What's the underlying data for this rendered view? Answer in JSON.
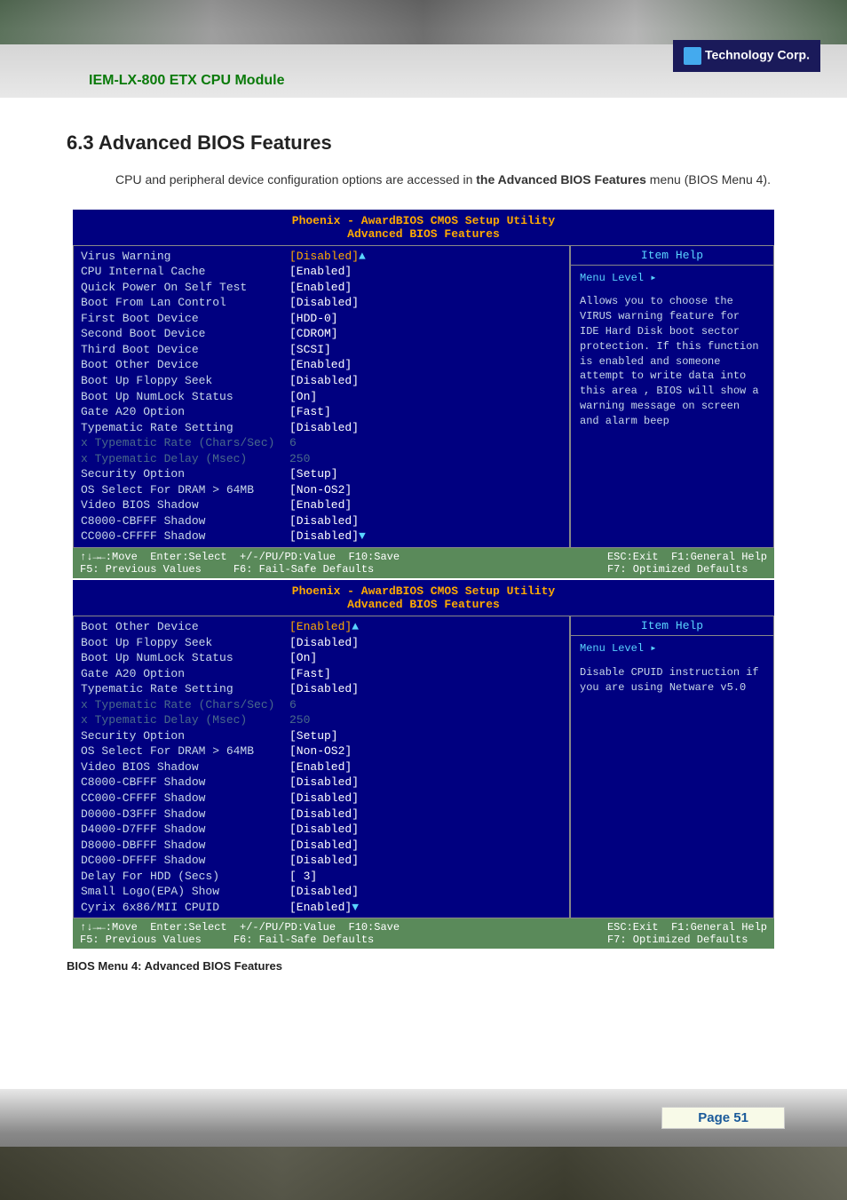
{
  "header": {
    "module": "IEM-LX-800 ETX CPU Module",
    "logo": "Technology Corp."
  },
  "section": {
    "heading": "6.3 Advanced BIOS Features",
    "intro_part1": "CPU and peripheral device configuration options are accessed in ",
    "intro_bold1": "the Advanced BIOS Features",
    "intro_part2": " menu (BIOS Menu 4)."
  },
  "bios1": {
    "title1": "Phoenix - AwardBIOS CMOS Setup Utility",
    "title2": "Advanced BIOS Features",
    "rows": [
      {
        "label": "Virus Warning",
        "value": "[Disabled]",
        "valClass": "yellow"
      },
      {
        "label": "CPU Internal Cache",
        "value": "[Enabled]"
      },
      {
        "label": "Quick Power On Self Test",
        "value": "[Enabled]"
      },
      {
        "label": "Boot From Lan Control",
        "value": "[Disabled]"
      },
      {
        "label": "First Boot Device",
        "value": "[HDD-0]"
      },
      {
        "label": "Second Boot Device",
        "value": "[CDROM]"
      },
      {
        "label": "Third Boot Device",
        "value": "[SCSI]"
      },
      {
        "label": "Boot Other Device",
        "value": "[Enabled]"
      },
      {
        "label": "Boot Up Floppy Seek",
        "value": "[Disabled]"
      },
      {
        "label": "Boot Up NumLock Status",
        "value": "[On]"
      },
      {
        "label": "Gate A20 Option",
        "value": "[Fast]"
      },
      {
        "label": "Typematic Rate Setting",
        "value": "[Disabled]"
      },
      {
        "label": "x Typematic Rate (Chars/Sec)",
        "value": "6",
        "dim": true
      },
      {
        "label": "x Typematic Delay (Msec)",
        "value": "250",
        "dim": true
      },
      {
        "label": "Security Option",
        "value": "[Setup]"
      },
      {
        "label": "OS Select For DRAM > 64MB",
        "value": "[Non-OS2]"
      },
      {
        "label": "Video BIOS Shadow",
        "value": "[Enabled]"
      },
      {
        "label": "C8000-CBFFF Shadow",
        "value": "[Disabled]"
      },
      {
        "label": "CC000-CFFFF Shadow",
        "value": "[Disabled]"
      }
    ],
    "help_title": "Item Help",
    "menu_level": "Menu Level   ▸",
    "help_text": "Allows you to choose the VIRUS warning feature for IDE Hard Disk boot sector protection. If this function is enabled and someone attempt to write data into this area , BIOS will show a warning message on screen and alarm beep",
    "footer_l1": "↑↓→←:Move  Enter:Select  +/-/PU/PD:Value  F10:Save",
    "footer_l2": "F5: Previous Values     F6: Fail-Safe Defaults",
    "footer_r1": "ESC:Exit  F1:General Help",
    "footer_r2": "F7: Optimized Defaults"
  },
  "bios2": {
    "title1": "Phoenix - AwardBIOS CMOS Setup Utility",
    "title2": "Advanced BIOS Features",
    "rows": [
      {
        "label": "Boot Other Device",
        "value": "[Enabled]",
        "valClass": "yellow"
      },
      {
        "label": "Boot Up Floppy Seek",
        "value": "[Disabled]"
      },
      {
        "label": "Boot Up NumLock Status",
        "value": "[On]"
      },
      {
        "label": "Gate A20 Option",
        "value": "[Fast]"
      },
      {
        "label": "Typematic Rate Setting",
        "value": "[Disabled]"
      },
      {
        "label": "x Typematic Rate (Chars/Sec)",
        "value": "6",
        "dim": true
      },
      {
        "label": "x Typematic Delay (Msec)",
        "value": "250",
        "dim": true
      },
      {
        "label": "Security Option",
        "value": "[Setup]"
      },
      {
        "label": "OS Select For DRAM > 64MB",
        "value": "[Non-OS2]"
      },
      {
        "label": "Video BIOS Shadow",
        "value": "[Enabled]"
      },
      {
        "label": "C8000-CBFFF Shadow",
        "value": "[Disabled]"
      },
      {
        "label": "CC000-CFFFF Shadow",
        "value": "[Disabled]"
      },
      {
        "label": "D0000-D3FFF Shadow",
        "value": "[Disabled]"
      },
      {
        "label": "D4000-D7FFF Shadow",
        "value": "[Disabled]"
      },
      {
        "label": "D8000-DBFFF Shadow",
        "value": "[Disabled]"
      },
      {
        "label": "DC000-DFFFF Shadow",
        "value": "[Disabled]"
      },
      {
        "label": "Delay For HDD (Secs)",
        "value": "[ 3]"
      },
      {
        "label": "Small Logo(EPA) Show",
        "value": "[Disabled]"
      },
      {
        "label": "Cyrix 6x86/MII CPUID",
        "value": "[Enabled]"
      }
    ],
    "help_title": "Item Help",
    "menu_level": "Menu Level   ▸",
    "help_text": "Disable CPUID instruction if you are using Netware v5.0",
    "footer_l1": "↑↓→←:Move  Enter:Select  +/-/PU/PD:Value  F10:Save",
    "footer_l2": "F5: Previous Values     F6: Fail-Safe Defaults",
    "footer_r1": "ESC:Exit  F1:General Help",
    "footer_r2": "F7: Optimized Defaults"
  },
  "caption": "BIOS Menu 4: Advanced BIOS Features",
  "page": "Page 51"
}
